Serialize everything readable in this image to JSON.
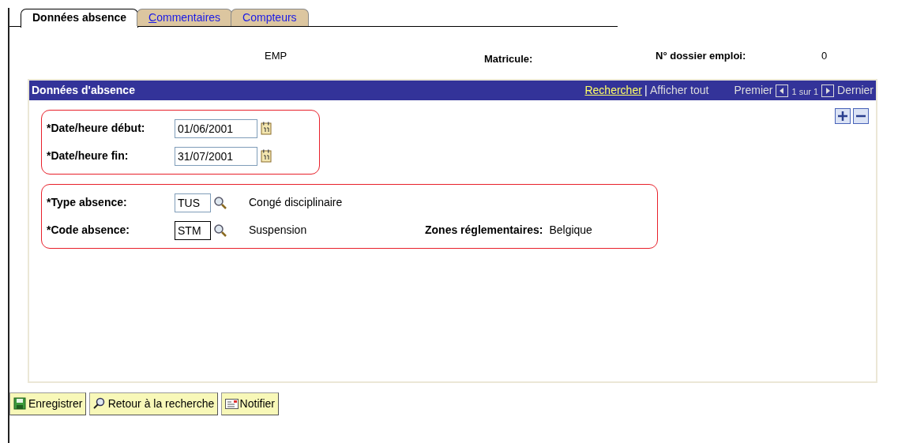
{
  "tabs": [
    {
      "label": "Données absence",
      "selected": true,
      "accesskey_underline": false
    },
    {
      "label": "Commentaires",
      "selected": false,
      "accesskey_underline": true
    },
    {
      "label": "Compteurs",
      "selected": false,
      "accesskey_underline": false
    }
  ],
  "header": {
    "employee": "EMP",
    "matricule_label": "Matricule:",
    "dossier_label": "N° dossier emploi:",
    "dossier_value": "0"
  },
  "panel": {
    "title": "Données d'absence",
    "search_link": "Rechercher",
    "separator": "|",
    "show_all": "Afficher tout",
    "first": "Premier",
    "position": "1 sur 1",
    "last": "Dernier",
    "groups": [
      {
        "fields": [
          {
            "kind": "date",
            "label": "*Date/heure début:",
            "value": "01/06/2001",
            "focused": false
          },
          {
            "kind": "date",
            "label": "*Date/heure fin:",
            "value": "31/07/2001",
            "focused": false
          }
        ]
      },
      {
        "fields": [
          {
            "kind": "lookup",
            "label": "*Type absence:",
            "value": "TUS",
            "focused": false,
            "description": "Congé disciplinaire"
          },
          {
            "kind": "lookup",
            "label": "*Code absence:",
            "value": "STM",
            "focused": true,
            "description": "Suspension",
            "extra_label": "Zones réglementaires:",
            "extra_value": "Belgique"
          }
        ]
      }
    ]
  },
  "buttons": [
    {
      "kind": "save",
      "label": "Enregistrer"
    },
    {
      "kind": "search",
      "label": "Retour à la recherche"
    },
    {
      "kind": "notify",
      "label": "Notifier"
    }
  ]
}
